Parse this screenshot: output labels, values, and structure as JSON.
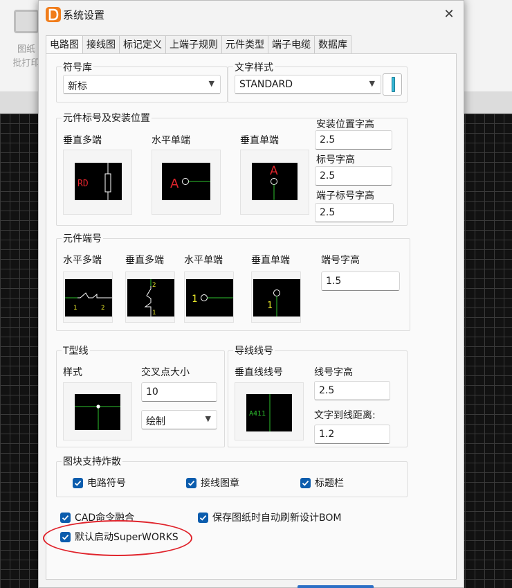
{
  "background": {
    "tool_label_1": "图纸",
    "tool_label_2": "批打印"
  },
  "dialog": {
    "title": "系统设置",
    "close_glyph": "✕",
    "tabs": [
      {
        "label": "电路图",
        "active": true
      },
      {
        "label": "接线图"
      },
      {
        "label": "标记定义"
      },
      {
        "label": "上端子规则"
      },
      {
        "label": "元件类型"
      },
      {
        "label": "端子电缆"
      },
      {
        "label": "数据库"
      }
    ]
  },
  "symbol_lib": {
    "title": "符号库",
    "value": "新标"
  },
  "text_style": {
    "title": "文字样式",
    "value": "STANDARD"
  },
  "component_marks": {
    "title": "元件标号及安装位置",
    "vertical_multi": "垂直多端",
    "horizontal_single": "水平单端",
    "vertical_single": "垂直单端",
    "install_height_label": "安装位置字高",
    "install_height": "2.5",
    "mark_height_label": "标号字高",
    "mark_height": "2.5",
    "terminal_mark_height_label": "端子标号字高",
    "terminal_mark_height": "2.5",
    "preview_text_rd": "RD",
    "preview_text_a": "A"
  },
  "component_terminals": {
    "title": "元件端号",
    "horizontal_multi": "水平多端",
    "vertical_multi": "垂直多端",
    "horizontal_single": "水平单端",
    "vertical_single": "垂直单端",
    "height_label": "端号字高",
    "height": "1.5",
    "preview_1": "1",
    "preview_2": "2"
  },
  "t_line": {
    "title": "T型线",
    "style_label": "样式",
    "cross_size_label": "交叉点大小",
    "cross_size": "10",
    "draw_mode": "绘制"
  },
  "wire_number": {
    "title": "导线线号",
    "vertical_label": "垂直线线号",
    "height_label": "线号字高",
    "height": "2.5",
    "distance_label": "文字到线距离:",
    "distance": "1.2",
    "preview_text": "A411"
  },
  "explode": {
    "title": "图块支持炸散",
    "options": [
      {
        "label": "电路符号",
        "checked": true
      },
      {
        "label": "接线图章",
        "checked": true
      },
      {
        "label": "标题栏",
        "checked": true
      }
    ]
  },
  "options": {
    "cad_merge": {
      "label": "CAD命令融合",
      "checked": true
    },
    "auto_refresh_bom": {
      "label": "保存图纸时自动刷新设计BOM",
      "checked": true
    },
    "default_superworks": {
      "label": "默认启动SuperWORKS",
      "checked": true
    }
  },
  "colors": {
    "accent": "#0b5cad",
    "preview_red": "#e0242c",
    "preview_green": "#2ec32e",
    "preview_yellow": "#e6e62a",
    "annotation": "#e0242c"
  }
}
